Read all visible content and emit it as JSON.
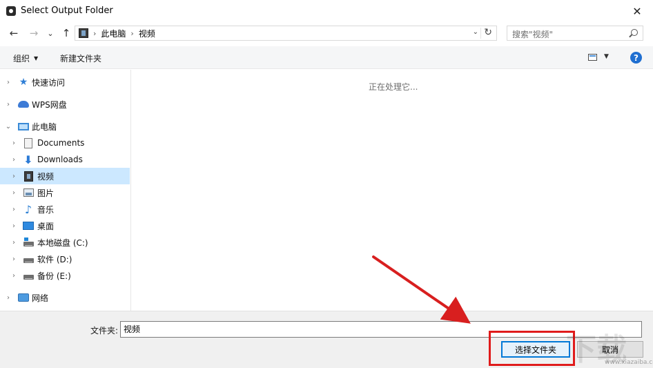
{
  "window": {
    "title": "Select Output Folder",
    "close_glyph": "✕"
  },
  "nav": {
    "back_glyph": "←",
    "forward_glyph": "→",
    "recent_glyph": "⌄",
    "up_glyph": "↑",
    "breadcrumbs": [
      "此电脑",
      "视频"
    ],
    "separator": "›",
    "dropdown_glyph": "⌄",
    "refresh_glyph": "↻",
    "search_placeholder": "搜索\"视频\""
  },
  "toolbar": {
    "organize_label": "组织",
    "organize_caret": "▼",
    "new_folder_label": "新建文件夹",
    "view_caret": "▼",
    "help_glyph": "?"
  },
  "tree": {
    "items": [
      {
        "label": "快速访问",
        "icon": "quick-access-star-icon",
        "chevron": "›"
      },
      {
        "label": "WPS网盘",
        "icon": "wps-cloud-icon",
        "chevron": "›"
      },
      {
        "label": "此电脑",
        "icon": "this-pc-icon",
        "chevron": "⌄"
      },
      {
        "label": "Documents",
        "icon": "documents-icon",
        "chevron": "›"
      },
      {
        "label": "Downloads",
        "icon": "downloads-icon",
        "chevron": "›"
      },
      {
        "label": "视频",
        "icon": "videos-icon",
        "chevron": "›",
        "selected": true
      },
      {
        "label": "图片",
        "icon": "pictures-icon",
        "chevron": "›"
      },
      {
        "label": "音乐",
        "icon": "music-icon",
        "chevron": "›"
      },
      {
        "label": "桌面",
        "icon": "desktop-icon",
        "chevron": "›"
      },
      {
        "label": "本地磁盘 (C:)",
        "icon": "local-disk-c-icon",
        "chevron": "›"
      },
      {
        "label": "软件 (D:)",
        "icon": "drive-d-icon",
        "chevron": "›"
      },
      {
        "label": "备份 (E:)",
        "icon": "drive-e-icon",
        "chevron": "›"
      },
      {
        "label": "网络",
        "icon": "network-icon",
        "chevron": "›"
      }
    ]
  },
  "content": {
    "status_text": "正在处理它..."
  },
  "footer": {
    "folder_label": "文件夹:",
    "folder_value": "视频",
    "select_button": "选择文件夹",
    "cancel_button": "取消"
  },
  "annotation": {
    "highlight_color": "#e01b1b"
  },
  "watermark": {
    "text": "下载吧",
    "url": "www.xiazaiba.com"
  },
  "colors": {
    "selection": "#cce8ff",
    "accent": "#0078d7",
    "help": "#1f6fd1"
  }
}
